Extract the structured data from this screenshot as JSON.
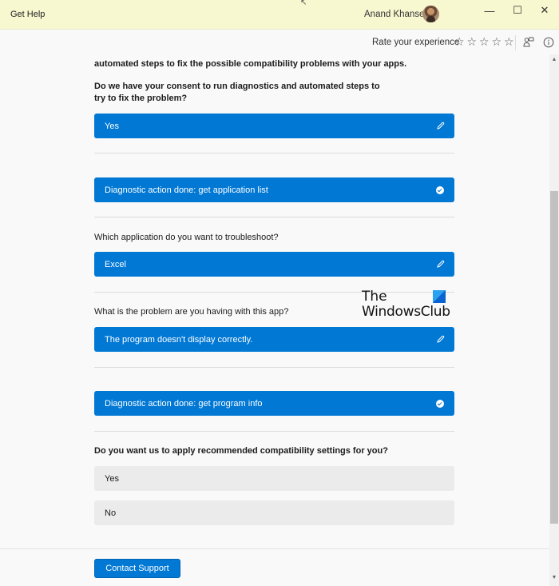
{
  "window": {
    "title": "Get Help",
    "user_name": "Anand Khanse",
    "controls": {
      "minimize": "—",
      "maximize": "☐",
      "close": "✕"
    }
  },
  "toolbar": {
    "rate_label": "Rate your experience",
    "stars": [
      "☆",
      "☆",
      "☆",
      "☆",
      "☆"
    ],
    "rating": 0,
    "icons": [
      "feedback-icon",
      "info-icon"
    ]
  },
  "conversation": {
    "intro_partial": "automated steps to fix the possible compatibility problems with your apps.",
    "consent_question": "Do we have your consent to run diagnostics and automated steps to try to fix the problem?",
    "consent_answer": "Yes",
    "diag1": "Diagnostic action done: get application list",
    "app_question": "Which application do you want to troubleshoot?",
    "app_answer": "Excel",
    "problem_question": "What is the problem are you having with this app?",
    "problem_answer": "The program doesn't display correctly.",
    "diag2": "Diagnostic action done: get program info",
    "settings_question": "Do you want us to apply recommended compatibility settings for you?",
    "options": [
      "Yes",
      "No"
    ]
  },
  "watermark": {
    "line1": "The",
    "line2": "WindowsClub"
  },
  "footer": {
    "contact_label": "Contact Support"
  },
  "colors": {
    "accent": "#0078d4",
    "titlebar_bg": "#f7f7d0",
    "option_bg": "#ebebeb"
  }
}
